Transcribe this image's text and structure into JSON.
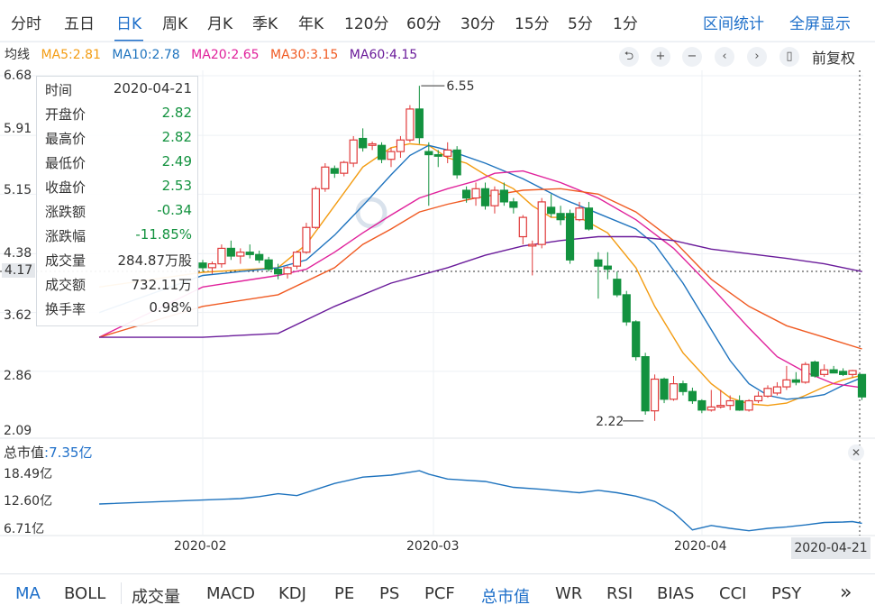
{
  "top_tabs": [
    {
      "label": "分时"
    },
    {
      "label": "五日"
    },
    {
      "label": "日K",
      "active": true
    },
    {
      "label": "周K"
    },
    {
      "label": "月K"
    },
    {
      "label": "季K"
    },
    {
      "label": "年K"
    },
    {
      "label": "120分"
    },
    {
      "label": "60分"
    },
    {
      "label": "30分"
    },
    {
      "label": "15分"
    },
    {
      "label": "5分"
    },
    {
      "label": "1分"
    }
  ],
  "top_links": {
    "interval": "区间统计",
    "fullscreen": "全屏显示"
  },
  "ma_legend": [
    {
      "label": "均线",
      "color": "#333333"
    },
    {
      "label": "MA5:2.81",
      "color": "#f39c12"
    },
    {
      "label": "MA10:2.78",
      "color": "#1e73be"
    },
    {
      "label": "MA20:2.65",
      "color": "#e0219b"
    },
    {
      "label": "MA30:3.15",
      "color": "#f05a22"
    },
    {
      "label": "MA60:4.15",
      "color": "#6a1b9a"
    }
  ],
  "toolbar": {
    "icons": [
      "undo-icon",
      "zoom-in-icon",
      "zoom-out-icon",
      "left-icon",
      "right-icon",
      "candle-icon"
    ],
    "glyphs": [
      "⮌",
      "+",
      "−",
      "‹",
      "›",
      "▯"
    ],
    "adjust": "前复权"
  },
  "y_ticks": [
    "6.68",
    "5.91",
    "5.15",
    "4.38",
    "3.62",
    "2.86",
    "2.09"
  ],
  "current_price_label": "4.17",
  "tooltip": {
    "rows": [
      {
        "k": "时间",
        "v": "2020-04-21",
        "c": "#333333"
      },
      {
        "k": "开盘价",
        "v": "2.82",
        "c": "#13923f"
      },
      {
        "k": "最高价",
        "v": "2.82",
        "c": "#13923f"
      },
      {
        "k": "最低价",
        "v": "2.49",
        "c": "#13923f"
      },
      {
        "k": "收盘价",
        "v": "2.53",
        "c": "#13923f"
      },
      {
        "k": "涨跌额",
        "v": "-0.34",
        "c": "#13923f"
      },
      {
        "k": "涨跌幅",
        "v": "-11.85%",
        "c": "#13923f"
      },
      {
        "k": "成交量",
        "v": "284.87万股",
        "c": "#333333"
      },
      {
        "k": "成交额",
        "v": "732.11万",
        "c": "#333333"
      },
      {
        "k": "换手率",
        "v": "0.98%",
        "c": "#333333"
      }
    ]
  },
  "annotations": {
    "high": "6.55",
    "low": "2.22"
  },
  "market_value": {
    "title": "总市值",
    "value": ":7.35亿",
    "y_ticks": [
      "18.49亿",
      "12.60亿",
      "6.71亿"
    ]
  },
  "x_labels": [
    "2020-02",
    "2020-03",
    "2020-04"
  ],
  "x_current": "2020-04-21",
  "bottom_tabs": [
    {
      "label": "MA",
      "active": true
    },
    {
      "label": "BOLL"
    },
    {
      "label": "成交量"
    },
    {
      "label": "MACD"
    },
    {
      "label": "KDJ"
    },
    {
      "label": "PE"
    },
    {
      "label": "PS"
    },
    {
      "label": "PCF"
    },
    {
      "label": "总市值",
      "active": true
    },
    {
      "label": "WR"
    },
    {
      "label": "RSI"
    },
    {
      "label": "BIAS"
    },
    {
      "label": "CCI"
    },
    {
      "label": "PSY"
    },
    {
      "label": "»"
    }
  ],
  "colors": {
    "up": "#e03a3a",
    "down": "#13923f",
    "accent": "#1e6fc9"
  },
  "chart_data": {
    "type": "candlestick",
    "y_range": [
      2.09,
      6.68
    ],
    "candles": [
      {
        "o": 4.26,
        "h": 4.3,
        "l": 4.15,
        "c": 4.2
      },
      {
        "o": 4.2,
        "h": 4.28,
        "l": 4.12,
        "c": 4.25
      },
      {
        "o": 4.25,
        "h": 4.5,
        "l": 4.2,
        "c": 4.45
      },
      {
        "o": 4.45,
        "h": 4.55,
        "l": 4.3,
        "c": 4.35
      },
      {
        "o": 4.35,
        "h": 4.45,
        "l": 4.25,
        "c": 4.4
      },
      {
        "o": 4.4,
        "h": 4.5,
        "l": 4.32,
        "c": 4.37
      },
      {
        "o": 4.37,
        "h": 4.42,
        "l": 4.26,
        "c": 4.3
      },
      {
        "o": 4.3,
        "h": 4.34,
        "l": 4.15,
        "c": 4.18
      },
      {
        "o": 4.18,
        "h": 4.25,
        "l": 4.05,
        "c": 4.12
      },
      {
        "o": 4.12,
        "h": 4.22,
        "l": 4.06,
        "c": 4.2
      },
      {
        "o": 4.22,
        "h": 4.42,
        "l": 4.18,
        "c": 4.4
      },
      {
        "o": 4.4,
        "h": 4.78,
        "l": 4.38,
        "c": 4.72
      },
      {
        "o": 4.72,
        "h": 5.25,
        "l": 4.7,
        "c": 5.22
      },
      {
        "o": 5.22,
        "h": 5.55,
        "l": 5.18,
        "c": 5.5
      },
      {
        "o": 5.48,
        "h": 5.52,
        "l": 5.36,
        "c": 5.42
      },
      {
        "o": 5.42,
        "h": 5.58,
        "l": 5.38,
        "c": 5.56
      },
      {
        "o": 5.55,
        "h": 5.9,
        "l": 5.5,
        "c": 5.85
      },
      {
        "o": 5.87,
        "h": 6.0,
        "l": 5.7,
        "c": 5.75
      },
      {
        "o": 5.78,
        "h": 5.83,
        "l": 5.72,
        "c": 5.8
      },
      {
        "o": 5.78,
        "h": 5.82,
        "l": 5.55,
        "c": 5.6
      },
      {
        "o": 5.6,
        "h": 5.75,
        "l": 5.5,
        "c": 5.7
      },
      {
        "o": 5.7,
        "h": 5.9,
        "l": 5.62,
        "c": 5.85
      },
      {
        "o": 5.85,
        "h": 6.3,
        "l": 5.82,
        "c": 6.25
      },
      {
        "o": 6.25,
        "h": 6.55,
        "l": 5.8,
        "c": 5.88
      },
      {
        "o": 5.7,
        "h": 5.82,
        "l": 5.0,
        "c": 5.66
      },
      {
        "o": 5.66,
        "h": 5.72,
        "l": 5.5,
        "c": 5.64
      },
      {
        "o": 5.64,
        "h": 5.82,
        "l": 5.55,
        "c": 5.72
      },
      {
        "o": 5.72,
        "h": 5.77,
        "l": 5.35,
        "c": 5.4
      },
      {
        "o": 5.2,
        "h": 5.25,
        "l": 5.04,
        "c": 5.1
      },
      {
        "o": 5.1,
        "h": 5.3,
        "l": 5.0,
        "c": 5.22
      },
      {
        "o": 5.22,
        "h": 5.3,
        "l": 4.95,
        "c": 5.0
      },
      {
        "o": 5.0,
        "h": 5.25,
        "l": 4.9,
        "c": 5.2
      },
      {
        "o": 5.2,
        "h": 5.3,
        "l": 5.0,
        "c": 5.05
      },
      {
        "o": 5.05,
        "h": 5.1,
        "l": 4.9,
        "c": 4.98
      },
      {
        "o": 4.6,
        "h": 4.88,
        "l": 4.5,
        "c": 4.85
      },
      {
        "o": 4.48,
        "h": 4.55,
        "l": 4.1,
        "c": 4.5
      },
      {
        "o": 4.5,
        "h": 5.1,
        "l": 4.45,
        "c": 5.05
      },
      {
        "o": 4.98,
        "h": 5.15,
        "l": 4.85,
        "c": 4.9
      },
      {
        "o": 4.9,
        "h": 5.0,
        "l": 4.75,
        "c": 4.82
      },
      {
        "o": 4.9,
        "h": 4.95,
        "l": 4.25,
        "c": 4.3
      },
      {
        "o": 4.82,
        "h": 5.05,
        "l": 4.8,
        "c": 4.97
      },
      {
        "o": 4.97,
        "h": 5.05,
        "l": 4.68,
        "c": 4.7
      },
      {
        "o": 4.3,
        "h": 4.4,
        "l": 3.8,
        "c": 4.22
      },
      {
        "o": 4.22,
        "h": 4.4,
        "l": 4.05,
        "c": 4.18
      },
      {
        "o": 4.05,
        "h": 4.15,
        "l": 3.82,
        "c": 3.85
      },
      {
        "o": 3.85,
        "h": 3.9,
        "l": 3.45,
        "c": 3.5
      },
      {
        "o": 3.5,
        "h": 3.52,
        "l": 3.0,
        "c": 3.05
      },
      {
        "o": 3.05,
        "h": 3.1,
        "l": 2.3,
        "c": 2.35
      },
      {
        "o": 2.35,
        "h": 2.82,
        "l": 2.22,
        "c": 2.76
      },
      {
        "o": 2.76,
        "h": 2.78,
        "l": 2.45,
        "c": 2.5
      },
      {
        "o": 2.5,
        "h": 2.8,
        "l": 2.48,
        "c": 2.7
      },
      {
        "o": 2.7,
        "h": 2.74,
        "l": 2.55,
        "c": 2.6
      },
      {
        "o": 2.6,
        "h": 2.65,
        "l": 2.44,
        "c": 2.48
      },
      {
        "o": 2.48,
        "h": 2.5,
        "l": 2.32,
        "c": 2.36
      },
      {
        "o": 2.36,
        "h": 2.62,
        "l": 2.34,
        "c": 2.4
      },
      {
        "o": 2.4,
        "h": 2.62,
        "l": 2.38,
        "c": 2.42
      },
      {
        "o": 2.42,
        "h": 2.55,
        "l": 2.36,
        "c": 2.48
      },
      {
        "o": 2.48,
        "h": 2.55,
        "l": 2.35,
        "c": 2.36
      },
      {
        "o": 2.36,
        "h": 2.5,
        "l": 2.34,
        "c": 2.48
      },
      {
        "o": 2.48,
        "h": 2.6,
        "l": 2.45,
        "c": 2.54
      },
      {
        "o": 2.54,
        "h": 2.68,
        "l": 2.52,
        "c": 2.64
      },
      {
        "o": 2.58,
        "h": 2.72,
        "l": 2.55,
        "c": 2.66
      },
      {
        "o": 2.66,
        "h": 2.93,
        "l": 2.62,
        "c": 2.75
      },
      {
        "o": 2.75,
        "h": 2.85,
        "l": 2.68,
        "c": 2.72
      },
      {
        "o": 2.72,
        "h": 2.98,
        "l": 2.7,
        "c": 2.95
      },
      {
        "o": 2.98,
        "h": 3.0,
        "l": 2.78,
        "c": 2.8
      },
      {
        "o": 2.82,
        "h": 2.95,
        "l": 2.79,
        "c": 2.88
      },
      {
        "o": 2.88,
        "h": 2.93,
        "l": 2.84,
        "c": 2.84
      },
      {
        "o": 2.86,
        "h": 2.9,
        "l": 2.8,
        "c": 2.82
      },
      {
        "o": 2.82,
        "h": 2.88,
        "l": 2.78,
        "c": 2.87
      },
      {
        "o": 2.82,
        "h": 2.82,
        "l": 2.49,
        "c": 2.53
      }
    ],
    "ma": [
      {
        "name": "MA5",
        "color": "#f39c12",
        "points": [
          [
            -11,
            3.95
          ],
          [
            0,
            4.14
          ],
          [
            8,
            4.2
          ],
          [
            11,
            4.5
          ],
          [
            14,
            5.0
          ],
          [
            17,
            5.5
          ],
          [
            20,
            5.75
          ],
          [
            22,
            5.8
          ],
          [
            24,
            5.78
          ],
          [
            26,
            5.62
          ],
          [
            28,
            5.55
          ],
          [
            30,
            5.4
          ],
          [
            33,
            5.22
          ],
          [
            35,
            5.0
          ],
          [
            37,
            4.85
          ],
          [
            40,
            4.85
          ],
          [
            43,
            4.65
          ],
          [
            46,
            4.2
          ],
          [
            48,
            3.7
          ],
          [
            51,
            3.1
          ],
          [
            54,
            2.7
          ],
          [
            56,
            2.52
          ],
          [
            58,
            2.44
          ],
          [
            60,
            2.42
          ],
          [
            62,
            2.45
          ],
          [
            64,
            2.55
          ],
          [
            66,
            2.66
          ],
          [
            68,
            2.75
          ],
          [
            70,
            2.81
          ]
        ]
      },
      {
        "name": "MA10",
        "color": "#1e73be",
        "points": [
          [
            -11,
            3.62
          ],
          [
            0,
            4.1
          ],
          [
            8,
            4.2
          ],
          [
            11,
            4.3
          ],
          [
            14,
            4.62
          ],
          [
            17,
            5.0
          ],
          [
            20,
            5.4
          ],
          [
            22,
            5.65
          ],
          [
            24,
            5.78
          ],
          [
            26,
            5.72
          ],
          [
            30,
            5.55
          ],
          [
            34,
            5.35
          ],
          [
            38,
            5.1
          ],
          [
            42,
            4.9
          ],
          [
            46,
            4.7
          ],
          [
            48,
            4.5
          ],
          [
            51,
            4.0
          ],
          [
            54,
            3.4
          ],
          [
            56,
            3.0
          ],
          [
            58,
            2.7
          ],
          [
            60,
            2.55
          ],
          [
            62,
            2.5
          ],
          [
            64,
            2.52
          ],
          [
            66,
            2.56
          ],
          [
            68,
            2.68
          ],
          [
            70,
            2.78
          ]
        ]
      },
      {
        "name": "MA20",
        "color": "#e0219b",
        "points": [
          [
            -11,
            3.3
          ],
          [
            0,
            3.95
          ],
          [
            8,
            4.1
          ],
          [
            11,
            4.18
          ],
          [
            14,
            4.4
          ],
          [
            17,
            4.65
          ],
          [
            20,
            4.88
          ],
          [
            23,
            5.1
          ],
          [
            26,
            5.22
          ],
          [
            29,
            5.32
          ],
          [
            31,
            5.42
          ],
          [
            34,
            5.45
          ],
          [
            38,
            5.3
          ],
          [
            42,
            5.1
          ],
          [
            46,
            4.82
          ],
          [
            50,
            4.45
          ],
          [
            54,
            3.95
          ],
          [
            58,
            3.42
          ],
          [
            61,
            3.05
          ],
          [
            64,
            2.85
          ],
          [
            67,
            2.7
          ],
          [
            70,
            2.65
          ]
        ]
      },
      {
        "name": "MA30",
        "color": "#f05a22",
        "points": [
          [
            -11,
            3.3
          ],
          [
            0,
            3.7
          ],
          [
            8,
            3.85
          ],
          [
            14,
            4.2
          ],
          [
            17,
            4.5
          ],
          [
            20,
            4.7
          ],
          [
            23,
            4.92
          ],
          [
            26,
            5.02
          ],
          [
            29,
            5.1
          ],
          [
            34,
            5.2
          ],
          [
            38,
            5.22
          ],
          [
            42,
            5.15
          ],
          [
            46,
            4.92
          ],
          [
            50,
            4.55
          ],
          [
            54,
            4.05
          ],
          [
            58,
            3.7
          ],
          [
            62,
            3.45
          ],
          [
            66,
            3.3
          ],
          [
            70,
            3.15
          ]
        ]
      },
      {
        "name": "MA60",
        "color": "#6a1b9a",
        "points": [
          [
            -11,
            3.3
          ],
          [
            0,
            3.3
          ],
          [
            8,
            3.35
          ],
          [
            14,
            3.7
          ],
          [
            20,
            4.0
          ],
          [
            26,
            4.2
          ],
          [
            30,
            4.36
          ],
          [
            34,
            4.48
          ],
          [
            38,
            4.55
          ],
          [
            42,
            4.6
          ],
          [
            46,
            4.6
          ],
          [
            50,
            4.55
          ],
          [
            54,
            4.44
          ],
          [
            58,
            4.38
          ],
          [
            62,
            4.32
          ],
          [
            66,
            4.25
          ],
          [
            70,
            4.15
          ]
        ]
      }
    ],
    "market_value": {
      "y_range": [
        5.2,
        18.49
      ],
      "points": [
        [
          -11,
          11.3
        ],
        [
          0,
          12.1
        ],
        [
          4,
          12.4
        ],
        [
          6,
          12.8
        ],
        [
          8,
          13.4
        ],
        [
          10,
          13.0
        ],
        [
          14,
          15.5
        ],
        [
          17,
          16.8
        ],
        [
          20,
          17.2
        ],
        [
          23,
          18.1
        ],
        [
          24,
          17.4
        ],
        [
          26,
          16.4
        ],
        [
          30,
          15.9
        ],
        [
          33,
          14.7
        ],
        [
          36,
          14.3
        ],
        [
          40,
          13.6
        ],
        [
          42,
          14.1
        ],
        [
          44,
          13.6
        ],
        [
          46,
          12.9
        ],
        [
          48,
          11.8
        ],
        [
          50,
          9.6
        ],
        [
          51,
          7.8
        ],
        [
          52,
          6.0
        ],
        [
          54,
          6.9
        ],
        [
          56,
          6.3
        ],
        [
          58,
          5.8
        ],
        [
          60,
          6.3
        ],
        [
          62,
          6.6
        ],
        [
          64,
          7.0
        ],
        [
          66,
          7.5
        ],
        [
          68,
          7.6
        ],
        [
          69,
          7.7
        ],
        [
          70,
          7.35
        ]
      ]
    }
  }
}
